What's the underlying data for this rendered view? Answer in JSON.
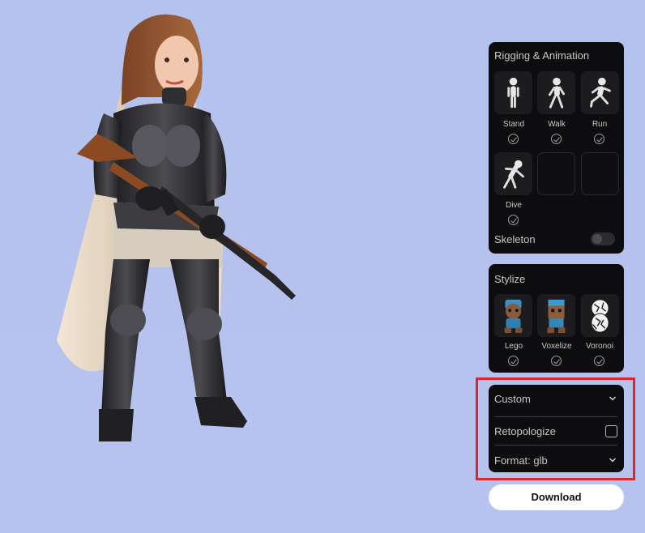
{
  "colors": {
    "background": "#b4c2ee",
    "panel": "#0d0d0f",
    "highlight": "#e0242b"
  },
  "viewport": {
    "subject": "3d-character-model"
  },
  "rigging": {
    "title": "Rigging & Animation",
    "animations": [
      {
        "label": "Stand",
        "icon": "stand-figure-icon",
        "checked": true
      },
      {
        "label": "Walk",
        "icon": "walk-figure-icon",
        "checked": true
      },
      {
        "label": "Run",
        "icon": "run-figure-icon",
        "checked": true
      },
      {
        "label": "Dive",
        "icon": "dive-figure-icon",
        "checked": true
      }
    ],
    "skeleton_label": "Skeleton",
    "skeleton_on": false
  },
  "stylize": {
    "title": "Stylize",
    "styles": [
      {
        "label": "Lego",
        "icon": "lego-bear-icon",
        "checked": true
      },
      {
        "label": "Voxelize",
        "icon": "voxel-bear-icon",
        "checked": true
      },
      {
        "label": "Voronoi",
        "icon": "voronoi-bear-icon",
        "checked": true
      }
    ]
  },
  "custom": {
    "title": "Custom",
    "retopologize_label": "Retopologize",
    "retopologize_checked": false,
    "format_label": "Format: glb"
  },
  "download_label": "Download"
}
